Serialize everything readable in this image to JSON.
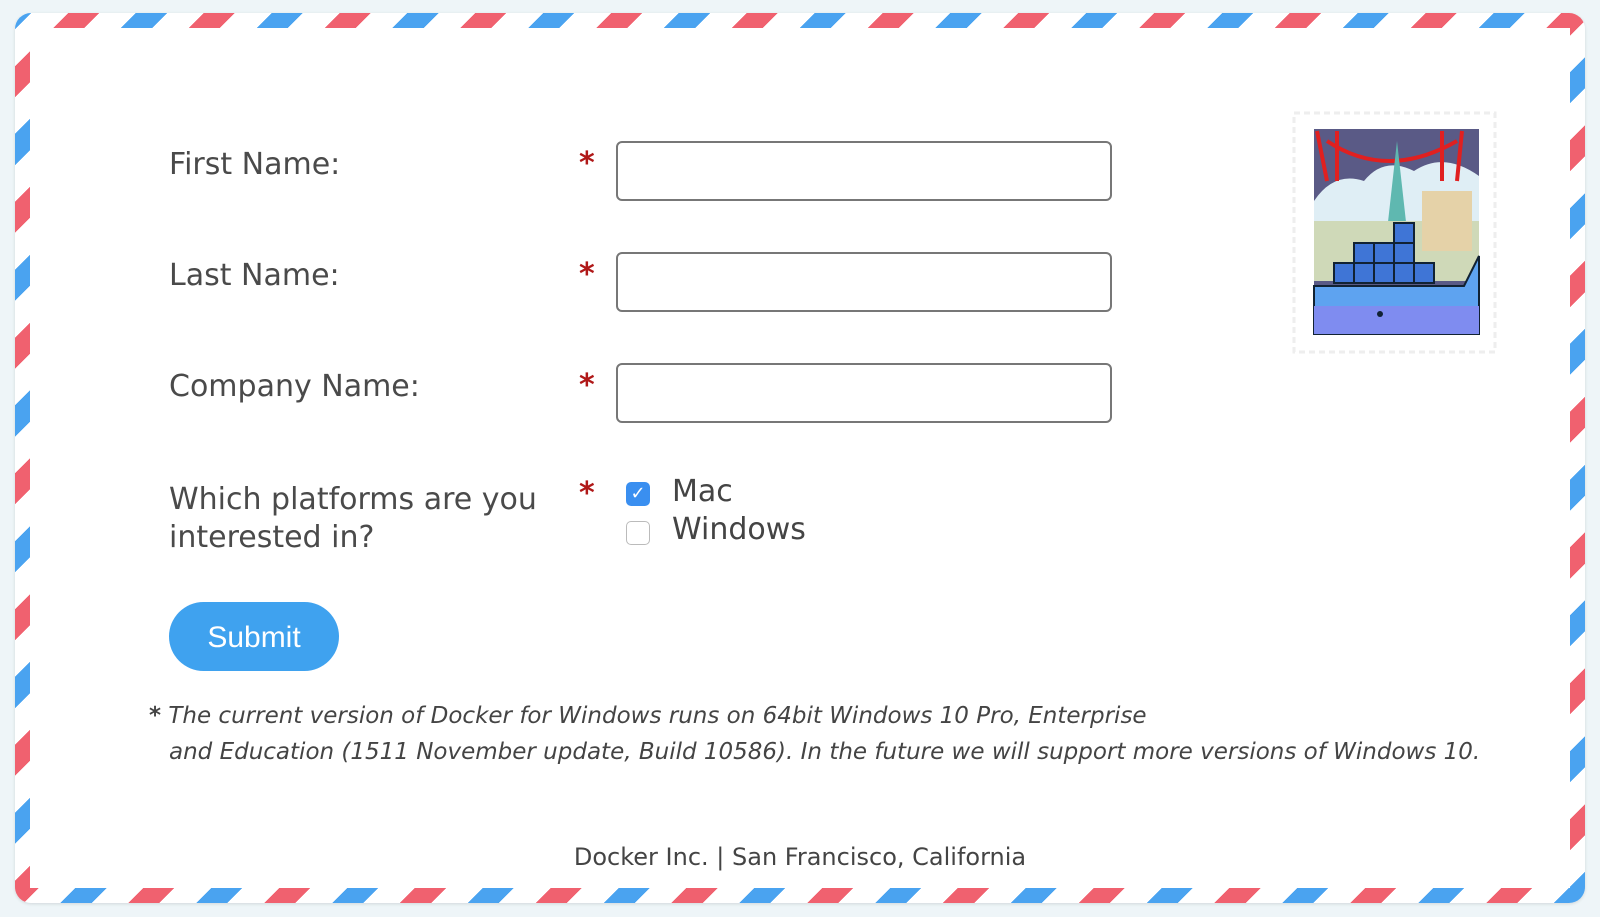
{
  "form": {
    "fields": [
      {
        "label": "First Name:",
        "required_mark": "*",
        "value": ""
      },
      {
        "label": "Last Name:",
        "required_mark": "*",
        "value": ""
      },
      {
        "label": "Company Name:",
        "required_mark": "*",
        "value": ""
      }
    ],
    "platforms": {
      "label_line1": "Which platforms are you",
      "label_line2": "interested in?",
      "required_mark": "*",
      "options": [
        {
          "label": "Mac",
          "checked": true
        },
        {
          "label": "Windows",
          "checked": false
        }
      ]
    },
    "submit_label": "Submit"
  },
  "footnote": {
    "mark": "*",
    "line1": "The current version of Docker for Windows runs on 64bit Windows 10 Pro, Enterprise",
    "line2": "and Education (1511 November update, Build 10586). In the future we will support more versions of Windows 10."
  },
  "footer": "Docker Inc. | San Francisco, California",
  "colors": {
    "stripe_blue": "#4aa3f0",
    "stripe_red": "#f0616f",
    "accent": "#3fa2ef",
    "required": "#b01818"
  },
  "stamp": {
    "icon": "docker-whale-san-francisco-stamp"
  }
}
